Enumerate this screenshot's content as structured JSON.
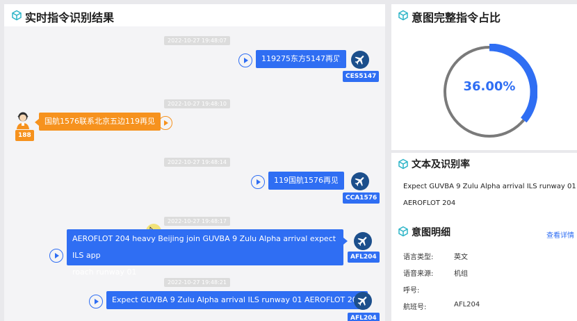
{
  "left_panel": {
    "title": "实时指令识别结果"
  },
  "messages": [
    {
      "time": "2022-10-27 19:48:07",
      "text": "119275东方5147再见",
      "callsign": "CES5147"
    },
    {
      "time": "2022-10-27 19:48:10",
      "text": "国航1576联系北京五边119再见",
      "badge": "188"
    },
    {
      "time": "2022-10-27 19:48:14",
      "text": "119国航1576再见",
      "callsign": "CCA1576"
    },
    {
      "time": "2022-10-27 19:48:17",
      "text_line1": "AEROFLOT 204 heavy Beijing join GUVBA 9 Zulu Alpha arrival expect ILS app",
      "text_line2": "roach runway 01",
      "callsign": "AFL204"
    },
    {
      "time": "2022-10-27 19:48:21",
      "text": "Expect GUVBA 9 Zulu Alpha arrival ILS runway 01 AEROFLOT 204",
      "callsign": "AFL204"
    }
  ],
  "donut": {
    "title": "意图完整指令占比",
    "value_label": "36.00%",
    "value": 0.36,
    "color": "#2f6ef3",
    "track_color": "#7a7a7a"
  },
  "text_section": {
    "title": "文本及识别率",
    "line1": "Expect GUVBA 9 Zulu Alpha arrival ILS runway 01",
    "line2": "AEROFLOT 204"
  },
  "detail_section": {
    "title": "意图明细",
    "link": "查看详情",
    "rows": [
      {
        "label": "语言类型:",
        "value": "英文"
      },
      {
        "label": "语音来源:",
        "value": "机组"
      },
      {
        "label": "呼号:",
        "value": ""
      },
      {
        "label": "航班号:",
        "value": "AFL204"
      }
    ]
  },
  "colors": {
    "accent": "#2f6ef3",
    "orange": "#f6921e",
    "plane_bg": "#1c4f8c"
  }
}
